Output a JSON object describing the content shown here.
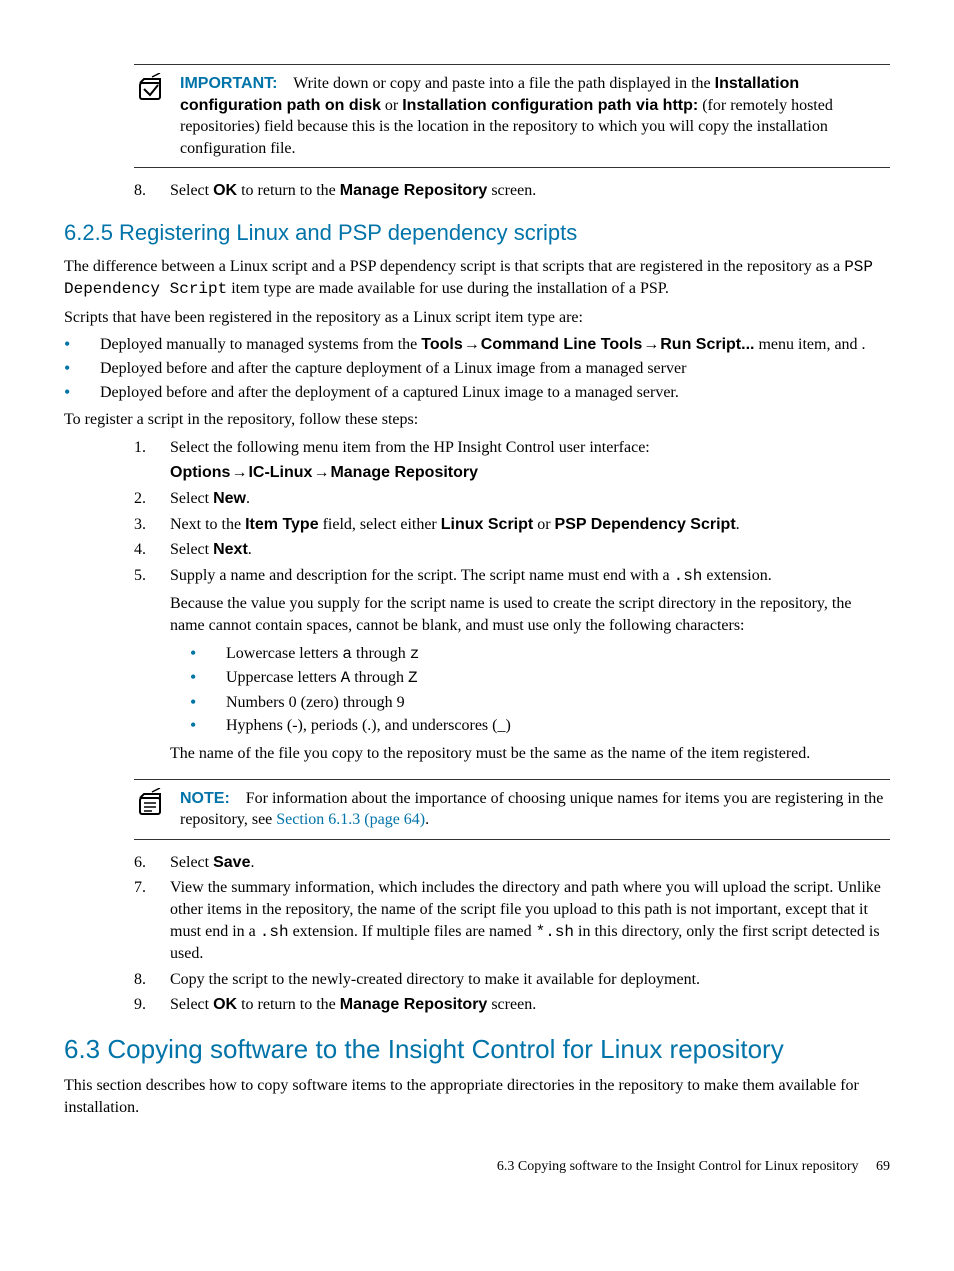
{
  "admon1": {
    "label": "IMPORTANT:",
    "text_a": "Write down or copy and paste into a file the path displayed in the ",
    "bold_b": "Installation configuration path on disk",
    "text_c": " or ",
    "bold_d": "Installation configuration path via http:",
    "text_e": " (for remotely hosted repositories) field because this is the location in the repository to which you will copy the installation configuration file."
  },
  "step8a": {
    "num": "8.",
    "a": "Select ",
    "ok": "OK",
    "b": " to return to the ",
    "mr": "Manage Repository",
    "c": " screen."
  },
  "h625": "6.2.5 Registering Linux and PSP dependency scripts",
  "p625a": {
    "a": "The difference between a Linux script and a PSP dependency script is that scripts that are registered in the repository as a ",
    "mono": "PSP Dependency Script",
    "b": " item type are made available for use during the installation of a PSP."
  },
  "p625b": "Scripts that have been registered in the repository as a Linux script item type are:",
  "bul625": {
    "i1": {
      "a": "Deployed manually to managed systems from the ",
      "b1": "Tools",
      "arr1": "→",
      "b2": "Command Line Tools",
      "arr2": "→",
      "b3": "Run Script...",
      "c": " menu item, and ."
    },
    "i2": "Deployed before and after the capture deployment of a Linux image from a managed server",
    "i3": "Deployed before and after the deployment of a captured Linux image to a managed server."
  },
  "p625c": "To register a script in the repository, follow these steps:",
  "steps": {
    "s1": {
      "num": "1.",
      "a": "Select the following menu item from the HP Insight Control user interface:",
      "path": {
        "p1": "Options",
        "a1": "→",
        "p2": "IC-Linux",
        "a2": "→",
        "p3": "Manage Repository"
      }
    },
    "s2": {
      "num": "2.",
      "a": "Select ",
      "b": "New",
      "c": "."
    },
    "s3": {
      "num": "3.",
      "a": "Next to the ",
      "b1": "Item Type",
      "c": " field, select either ",
      "b2": "Linux Script",
      "d": " or ",
      "b3": "PSP Dependency Script",
      "e": "."
    },
    "s4": {
      "num": "4.",
      "a": "Select ",
      "b": "Next",
      "c": "."
    },
    "s5": {
      "num": "5.",
      "a": "Supply a name and description for the script. The script name must end with a ",
      "mono": ".sh",
      "b": " extension.",
      "p2": "Because the value you supply for the script name is used to create the script directory in the repository, the name cannot contain spaces, cannot be blank, and must use only the following characters:",
      "chars": {
        "c1a": "Lowercase letters ",
        "c1m1": "a",
        "c1b": " through ",
        "c1m2": "z",
        "c2a": "Uppercase letters ",
        "c2m1": "A",
        "c2b": " through ",
        "c2m2": "Z",
        "c3": "Numbers 0 (zero) through 9",
        "c4": "Hyphens (-), periods (.), and underscores (_)"
      },
      "p3": "The name of the file you copy to the repository must be the same as the name of the item registered."
    },
    "s6": {
      "num": "6.",
      "a": "Select ",
      "b": "Save",
      "c": "."
    },
    "s7": {
      "num": "7.",
      "a": "View the summary information, which includes the directory and path where you will upload the script. Unlike other items in the repository, the name of the script file you upload to this path is not important, except that it must end in a ",
      "mono1": ".sh",
      "b": " extension. If multiple files are named ",
      "mono2": "*.sh",
      "c": " in this directory, only the first script detected is used."
    },
    "s8": {
      "num": "8.",
      "a": "Copy the script to the newly-created directory to make it available for deployment."
    },
    "s9": {
      "num": "9.",
      "a": "Select ",
      "ok": "OK",
      "b": " to return to the ",
      "mr": "Manage Repository",
      "c": " screen."
    }
  },
  "note": {
    "label": "NOTE:",
    "a": "For information about the importance of choosing unique names for items you are registering in the repository, see ",
    "link": "Section 6.1.3 (page 64)",
    "b": "."
  },
  "h63": "6.3 Copying software to the Insight Control for Linux repository",
  "p63": "This section describes how to copy software items to the appropriate directories in the repository to make them available for installation.",
  "footer": {
    "text": "6.3 Copying software to the Insight Control for Linux repository",
    "page": "69"
  }
}
